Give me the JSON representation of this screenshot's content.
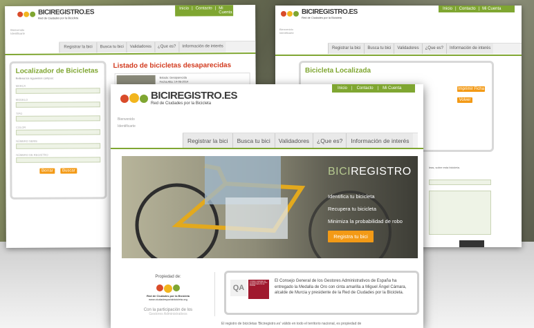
{
  "brand": {
    "name_a": "BICI",
    "name_b": "REGISTRO",
    "tld": ".ES",
    "tagline": "Red de Ciudades por la Bicicleta"
  },
  "topbar": {
    "inicio": "Inicio",
    "contacto": "Contacto",
    "cuenta": "Mi Cuenta"
  },
  "user": {
    "line1": "Bienvenido",
    "line2": "Identificarte"
  },
  "nav": [
    "Registrar la bici",
    "Busca tu bici",
    "Validadores",
    "¿Que es?",
    "Información de interés"
  ],
  "left_page": {
    "title": "Localizador de Bicicletas",
    "subtitle": "Rellena los siguientes campos:",
    "fields": [
      "MARCA",
      "MODELO",
      "TIPO",
      "COLOR",
      "NÚMERO SERIE",
      "NÚMERO DE REGISTRO"
    ],
    "buttons": [
      "Borrar",
      "Buscar"
    ],
    "list_title": "Listado de bicicletas desaparecidas",
    "row": {
      "estado": "Estado:",
      "estado_val": "Desaparecida",
      "fecha": "Fecha Alta:",
      "fecha_val": "14-06-2014"
    }
  },
  "right_page": {
    "title": "Bicicleta Localizada",
    "buttons": [
      "Imprimir Ficha",
      "Volver"
    ],
    "note": "leas, sobre esta bicicleta."
  },
  "hero": {
    "brand_a": "BICI",
    "brand_b": "REGISTRO",
    "lines": [
      "Identifica tu bicicleta",
      "Recupera tu bicicleta",
      "Minimiza la probabilidad de robo"
    ],
    "cta": "Registra tu bici"
  },
  "footer": {
    "propiedad": "Propiedad de:",
    "logo_caption": "Red de Ciudades por la Bicicleta",
    "logo_url": "www.ciudadesporlabicicleta.org",
    "participacion": "Con la participación de los",
    "participacion2": "Gestores Administrativos",
    "qa_letters": "QA",
    "qa_side": "CONSEJO GENERAL DE COLEGIOS DE GESTORES ADMINISTRATIVOS DE ESPAÑA",
    "qa_text": "El Consejo General de los Gestores Administrativos de España ha entregado la Medalla de Oro con cinta amarilla a Miguel Ángel Cámara, alcalde de Murcia y presidente de la Red de Ciudades por la Bicicleta.",
    "bottom": "El registro de bicicletas 'Biciregistro.es' válido en todo el territorio nacional, es propiedad de"
  },
  "colors": {
    "accent": "#7fa631",
    "orange": "#f39a16",
    "red": "#d23a1e"
  }
}
